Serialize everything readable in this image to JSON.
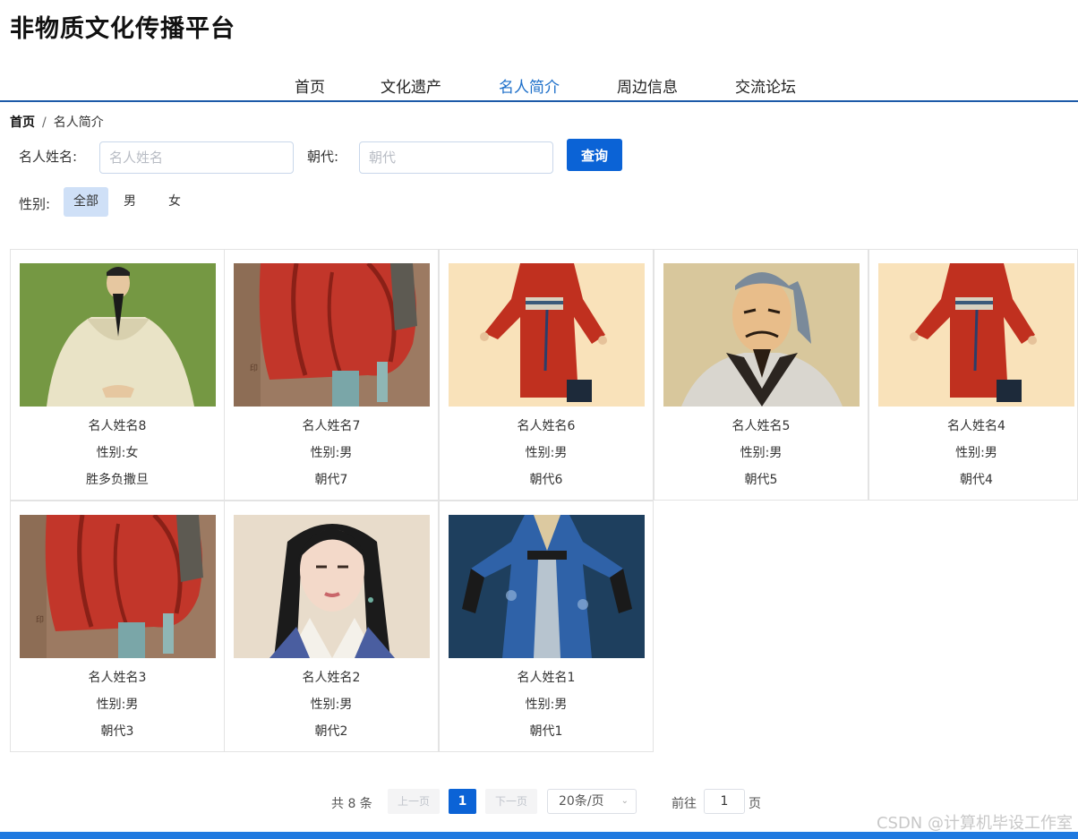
{
  "site": {
    "title": "非物质文化传播平台"
  },
  "nav": {
    "items": [
      "首页",
      "文化遗产",
      "名人简介",
      "周边信息",
      "交流论坛"
    ],
    "active": "名人简介"
  },
  "breadcrumb": {
    "home": "首页",
    "separator": "/",
    "current": "名人简介"
  },
  "search": {
    "name_label": "名人姓名:",
    "name_placeholder": "名人姓名",
    "dynasty_label": "朝代:",
    "dynasty_placeholder": "朝代",
    "query_button": "查询"
  },
  "gender_filter": {
    "label": "性别:",
    "options": [
      "全部",
      "男",
      "女"
    ],
    "selected": "全部"
  },
  "cards": [
    {
      "name": "名人姓名8",
      "gender": "性别:女",
      "dynasty": "胜多负撒旦",
      "image": "elder-in-white-robe"
    },
    {
      "name": "名人姓名7",
      "gender": "性别:男",
      "dynasty": "朝代7",
      "image": "red-robe-painting"
    },
    {
      "name": "名人姓名6",
      "gender": "性别:男",
      "dynasty": "朝代6",
      "image": "red-hanfu-figure"
    },
    {
      "name": "名人姓名5",
      "gender": "性别:男",
      "dynasty": "朝代5",
      "image": "scholar-portrait"
    },
    {
      "name": "名人姓名4",
      "gender": "性别:男",
      "dynasty": "朝代4",
      "image": "red-hanfu-figure"
    },
    {
      "name": "名人姓名3",
      "gender": "性别:男",
      "dynasty": "朝代3",
      "image": "red-robe-painting"
    },
    {
      "name": "名人姓名2",
      "gender": "性别:男",
      "dynasty": "朝代2",
      "image": "lady-portrait"
    },
    {
      "name": "名人姓名1",
      "gender": "性别:男",
      "dynasty": "朝代1",
      "image": "blue-hanfu-figure"
    }
  ],
  "pagination": {
    "total": "共 8 条",
    "prev": "上一页",
    "current_page": "1",
    "next": "下一页",
    "page_size": "20条/页",
    "goto_label": "前往",
    "goto_value": "1",
    "page_suffix": "页"
  },
  "watermark": "CSDN @计算机毕设工作室",
  "colors": {
    "accent": "#0b63d6",
    "nav_underline": "#1d5aa8",
    "active_nav": "#1d6fc9",
    "bottom_bar": "#1f7ae0"
  }
}
